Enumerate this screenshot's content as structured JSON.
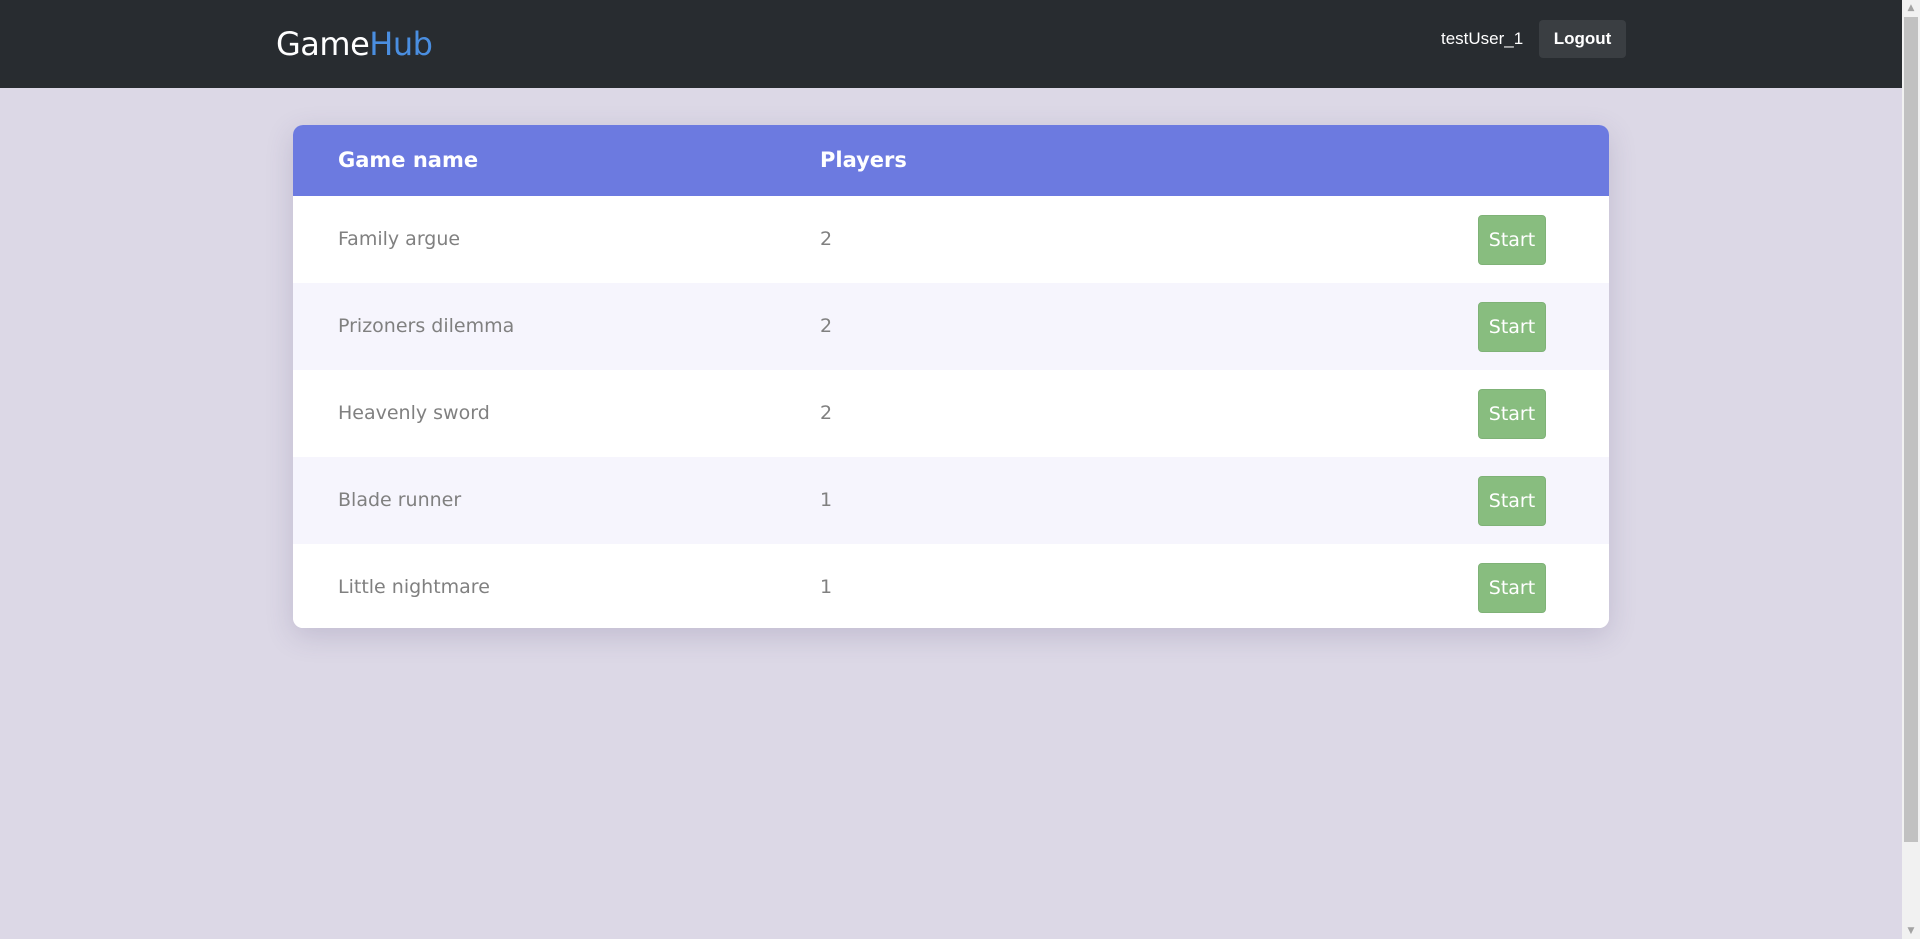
{
  "navbar": {
    "logo_part1": "Game",
    "logo_part2": "Hub",
    "username": "testUser_1",
    "logout_label": "Logout"
  },
  "table": {
    "headers": {
      "name": "Game name",
      "players": "Players"
    },
    "rows": [
      {
        "name": "Family argue",
        "players": "2",
        "action": "Start"
      },
      {
        "name": "Prizoners dilemma",
        "players": "2",
        "action": "Start"
      },
      {
        "name": "Heavenly sword",
        "players": "2",
        "action": "Start"
      },
      {
        "name": "Blade runner",
        "players": "1",
        "action": "Start"
      },
      {
        "name": "Little nightmare",
        "players": "1",
        "action": "Start"
      }
    ]
  },
  "colors": {
    "navbar_bg": "#282c30",
    "page_bg": "#dcd8e6",
    "header_accent": "#6c7ae0",
    "logo_accent": "#4a8ee0",
    "start_button": "#88bd7f"
  },
  "icons": {
    "scroll_up": "scroll-up-arrow-icon",
    "scroll_down": "scroll-down-arrow-icon"
  }
}
